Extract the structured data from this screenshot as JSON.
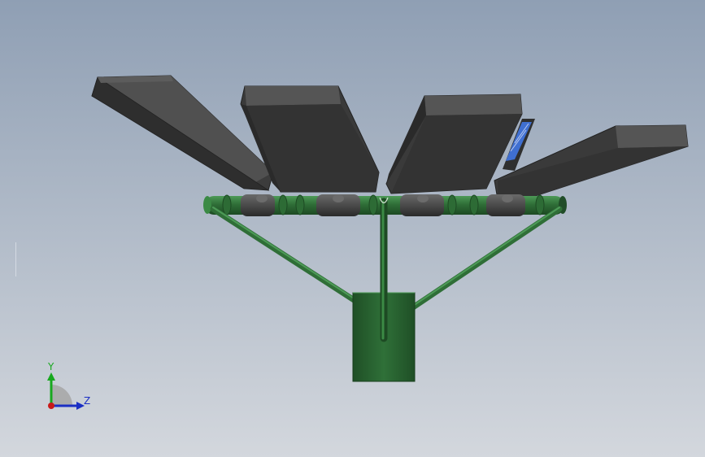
{
  "viewport": {
    "background_top": "#8f9fb4",
    "background_bottom": "#d3d7dd"
  },
  "model": {
    "pole_color": "#2f6e37",
    "pole_dark": "#1d4a23",
    "pole_light": "#4d9a57",
    "lamp_top": "#555555",
    "lamp_side": "#3c3c3c",
    "lamp_front": "#2e2e2e",
    "led_panel": "#3f6fd1",
    "joint_color": "#4a4a4a"
  },
  "triad": {
    "y_label": "Y",
    "z_label": "Z",
    "y_color": "#18a81f",
    "z_color": "#1b2fc4",
    "origin_color": "#c81a1a"
  }
}
